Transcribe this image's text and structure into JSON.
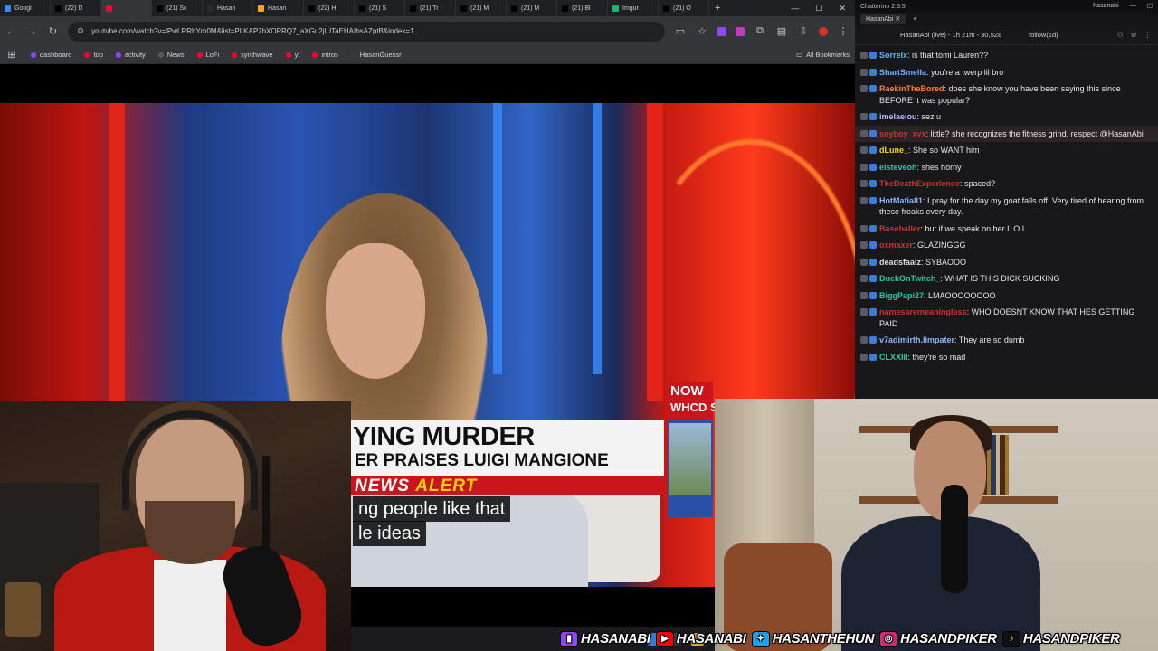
{
  "browser": {
    "tabs": [
      {
        "label": "Googl",
        "color": "#4285f4"
      },
      {
        "label": "(22) D",
        "color": "#000000"
      },
      {
        "label": "",
        "color": "#ff0033"
      },
      {
        "label": "(21) Sc",
        "color": "#000000"
      },
      {
        "label": "Hasan",
        "color": "#2b2b2b"
      },
      {
        "label": "Hasan",
        "color": "#f2a81d"
      },
      {
        "label": "(22) H",
        "color": "#000000"
      },
      {
        "label": "(21) S",
        "color": "#000000"
      },
      {
        "label": "(21) Tr",
        "color": "#000000"
      },
      {
        "label": "(21) M",
        "color": "#000000"
      },
      {
        "label": "(21) M",
        "color": "#000000"
      },
      {
        "label": "(21) Bl",
        "color": "#000000"
      },
      {
        "label": "Imgur",
        "color": "#1bb76e"
      },
      {
        "label": "(21) O",
        "color": "#000000"
      }
    ],
    "url": "youtube.com/watch?v=lPwLRRbYm0M&list=PLKAP7bXOPRQ7_aXGu2jlUTaEHAIbsAZptB&index=1",
    "bookmarks": [
      {
        "label": "dashboard",
        "color": "#9146ff"
      },
      {
        "label": "top",
        "color": "#ff0033"
      },
      {
        "label": "activity",
        "color": "#9146ff"
      },
      {
        "label": "News",
        "color": "#5a5a5a"
      },
      {
        "label": "LoFi",
        "color": "#ff0033"
      },
      {
        "label": "synthwave",
        "color": "#ff0033"
      },
      {
        "label": "yt",
        "color": "#ff0033"
      },
      {
        "label": "intros",
        "color": "#ff0033"
      },
      {
        "label": "HasanGuessr",
        "color": "#3a3a3a"
      }
    ],
    "all_bookmarks": "All Bookmarks"
  },
  "video": {
    "headline": "YING MURDER",
    "subheadline": "ER PRAISES LUIGI MANGIONE",
    "alert_prefix": "NEWS ",
    "alert_word": "ALERT",
    "now_line1": "NOW",
    "now_line2": "WHCD S",
    "caption_line1": "ng people like that",
    "caption_line2": "le ideas"
  },
  "chat": {
    "app_title": "Chatterino 2.5.5",
    "account": "hasanabi",
    "tab": "HasanAbi",
    "header_title": "HasanAbi (live) - 1h 21m - 30,528",
    "follow": "follow(1d)",
    "messages": [
      {
        "user": "Sorrelx",
        "color": "#6ab0ff",
        "text": "is that tomi Lauren??",
        "hl": false
      },
      {
        "user": "ShartSmella",
        "color": "#6ab0ff",
        "text": "you're a twerp lil bro",
        "hl": false
      },
      {
        "user": "RaekinTheBored",
        "color": "#ff7f32",
        "text": "does she know you have been saying this since BEFORE it was popular?",
        "hl": false
      },
      {
        "user": "imelaeiou",
        "color": "#b6b6ff",
        "text": "sez u",
        "hl": false
      },
      {
        "user": "soyboy_xvx",
        "color": "#c0392b",
        "text": "little? she recognizes the fitness grind. respect @HasanAbi",
        "hl": true
      },
      {
        "user": "dLune_",
        "color": "#f5d020",
        "text": "She so WANT him",
        "hl": false
      },
      {
        "user": "elsteveoh",
        "color": "#29c7a7",
        "text": "shes horny",
        "hl": false
      },
      {
        "user": "TheDeathExperience",
        "color": "#c0392b",
        "text": "spaced?",
        "hl": false
      },
      {
        "user": "HotMafia81",
        "color": "#8ab4ff",
        "text": "I pray for the day my goat falls off. Very tired of hearing from these freaks every day.",
        "hl": false
      },
      {
        "user": "Baseballer",
        "color": "#c0392b",
        "text": "but if we speak on her L O L",
        "hl": false
      },
      {
        "user": "oxmaxer",
        "color": "#c0392b",
        "text": "GLAZINGGG",
        "hl": false
      },
      {
        "user": "deadsfaalz",
        "color": "#dcdcdc",
        "text": "SYBAOOO",
        "hl": false
      },
      {
        "user": "DuckOnTwitch_",
        "color": "#29c7a7",
        "text": "WHAT IS THIS DICK SUCKING",
        "hl": false
      },
      {
        "user": "BiggPapi27",
        "color": "#29c7a7",
        "text": "LMAOOOOOOOO",
        "hl": false
      },
      {
        "user": "namesaremeaningless",
        "color": "#c0392b",
        "text": "WHO DOESNT KNOW THAT HES GETTING PAID",
        "hl": false
      },
      {
        "user": "v7adimirth.limpater",
        "color": "#8ab4ff",
        "text": "They are so dumb",
        "hl": false
      },
      {
        "user": "CLXXIII",
        "color": "#29c7a7",
        "text": "they're so mad",
        "hl": false
      }
    ]
  },
  "socials": [
    {
      "platform": "twitch",
      "handle": "HASANABI",
      "color": "#9146ff",
      "glyph": "▮"
    },
    {
      "platform": "youtube",
      "handle": "HASANABI",
      "color": "#ff0000",
      "glyph": "▶"
    },
    {
      "platform": "twitter",
      "handle": "HASANTHEHUN",
      "color": "#1da1f2",
      "glyph": "✦"
    },
    {
      "platform": "instagram",
      "handle": "HASANDPIKER",
      "color": "#d62976",
      "glyph": "◎"
    },
    {
      "platform": "tiktok",
      "handle": "HASANDPIKER",
      "color": "#111111",
      "glyph": "♪"
    }
  ]
}
